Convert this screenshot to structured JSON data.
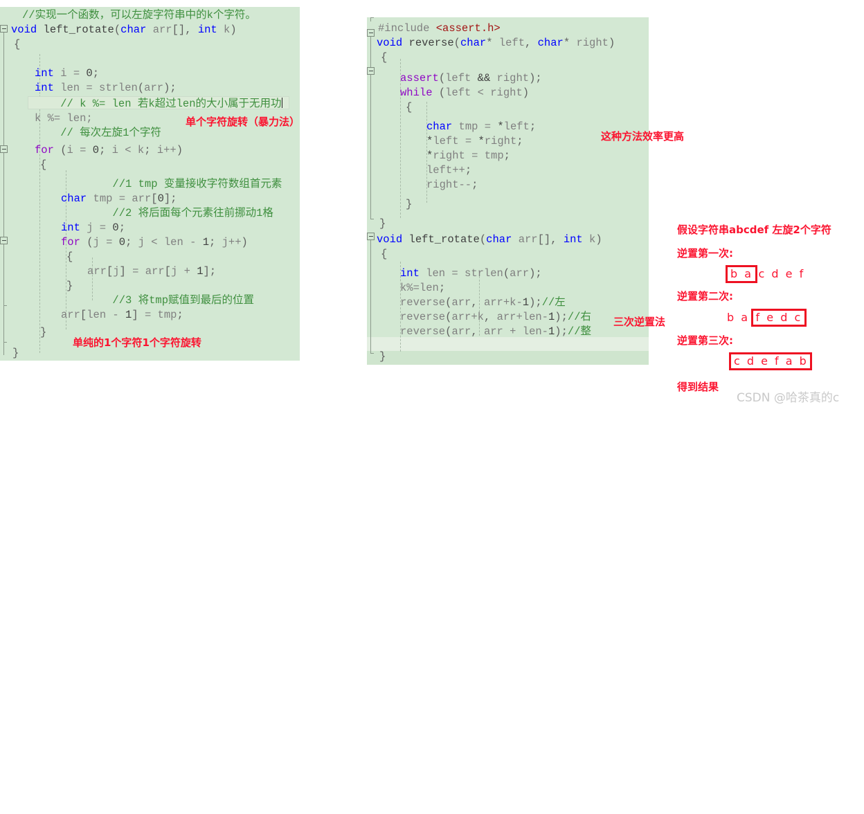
{
  "left_panel": {
    "name": "left-rotate-brute-force-code",
    "background": "#d3e8d3",
    "lines": [
      "//实现一个函数，可以左旋字符串中的k个字符。",
      "void left_rotate(char arr[], int k)",
      "{",
      "    int i = 0;",
      "    int len = strlen(arr);",
      "    // k %= len 若k超过len的大小属于无用功",
      "    k %= len;",
      "    // 每次左旋1个字符",
      "    for (i = 0; i < k; i++)",
      "    {",
      "        //1 tmp 变量接收字符数组首元素",
      "        char tmp = arr[0];",
      "        //2 将后面每个元素往前挪动1格",
      "        int j = 0;",
      "        for (j = 0; j < len - 1; j++)",
      "        {",
      "            arr[j] = arr[j + 1];",
      "        }",
      "        //3 将tmp赋值到最后的位置",
      "        arr[len - 1] = tmp;",
      "    }",
      "}"
    ],
    "annotations": [
      {
        "text": "单个字符旋转（暴力法）",
        "name": "annotation-single-char-rotation"
      },
      {
        "text": "单纯的1个字符1个字符旋转",
        "name": "annotation-pure-one-by-one"
      }
    ]
  },
  "mid_panel": {
    "name": "three-reverse-code",
    "background": "#d3e8d3",
    "lines": [
      "#include <assert.h>",
      "void reverse(char* left, char* right)",
      "{",
      "    assert(left && right);",
      "    while (left < right)",
      "    {",
      "        char tmp = *left;",
      "        *left = *right;",
      "        *right = tmp;",
      "        left++;",
      "        right--;",
      "    }",
      "}",
      "void left_rotate(char arr[], int k)",
      "{",
      "    int len = strlen(arr);",
      "    k%=len;",
      "    reverse(arr, arr+k-1);//左",
      "    reverse(arr+k, arr+len-1);//右",
      "    reverse(arr, arr + len-1);//整",
      "}"
    ],
    "annotations": [
      {
        "text": "这种方法效率更高",
        "name": "annotation-more-efficient"
      },
      {
        "text": "三次逆置法",
        "name": "annotation-three-reverse-method"
      }
    ]
  },
  "right_diagram": {
    "title": "假设字符串abcdef 左旋2个字符",
    "steps": [
      {
        "label": "逆置第一次:",
        "name": "reverse-step-1",
        "boxed_first": true,
        "boxed": "b a",
        "plain": "c d e f"
      },
      {
        "label": "逆置第二次:",
        "name": "reverse-step-2",
        "boxed_first": false,
        "plain": "b a",
        "boxed": "f e d c"
      },
      {
        "label": "逆置第三次:",
        "name": "reverse-step-3",
        "boxed_first": true,
        "boxed": "c d e f a b",
        "plain": ""
      }
    ],
    "result_label": "得到结果"
  },
  "watermark": "CSDN @哈茶真的c",
  "colors": {
    "code_bg": "#d3e8d3",
    "annotation_red": "#fb1430",
    "box_red": "#ee1122",
    "keyword_blue": "#0000ff",
    "control_purple": "#8f08c4",
    "comment_green": "#3f8f3f",
    "plain_gray": "#808080",
    "watermark_gray": "#c9c9c9"
  }
}
